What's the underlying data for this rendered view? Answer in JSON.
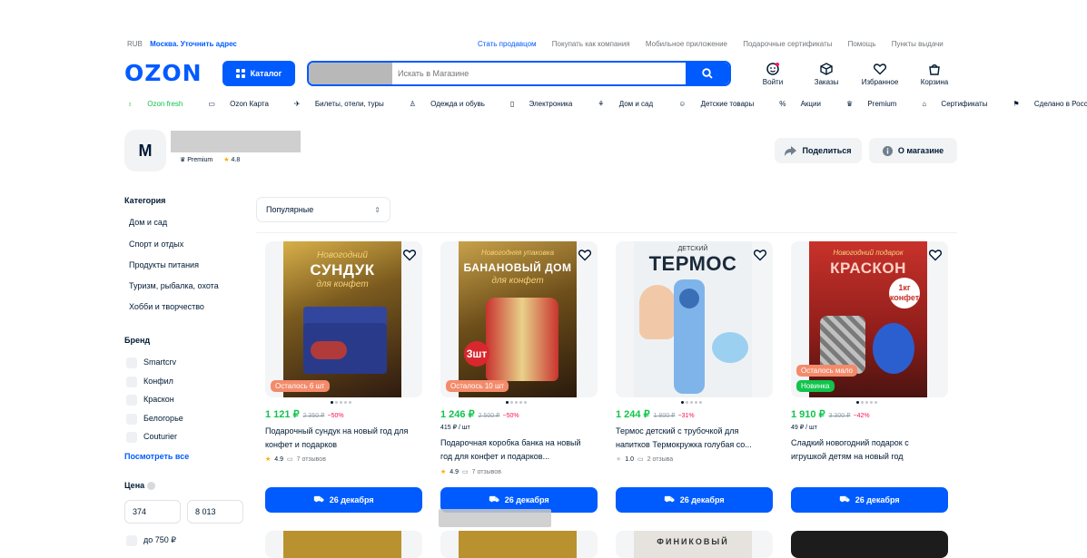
{
  "topbar": {
    "currency": "RUB",
    "location": "Москва. Уточнить адрес",
    "links": [
      "Стать продавцом",
      "Покупать как компания",
      "Мобильное приложение",
      "Подарочные сертификаты",
      "Помощь",
      "Пункты выдачи"
    ]
  },
  "header": {
    "logo": "OZON",
    "catalog_label": "Каталог",
    "search_placeholder": "Искать в Магазине",
    "icons": [
      {
        "label": "Войти",
        "icon": "user-face-icon"
      },
      {
        "label": "Заказы",
        "icon": "box-icon"
      },
      {
        "label": "Избранное",
        "icon": "heart-icon"
      },
      {
        "label": "Корзина",
        "icon": "bag-icon"
      }
    ]
  },
  "nav": [
    "Ozon fresh",
    "Ozon Карта",
    "Билеты, отели, туры",
    "Одежда и обувь",
    "Электроника",
    "Дом и сад",
    "Детские товары",
    "Акции",
    "Premium",
    "Сертификаты",
    "Сделано в России"
  ],
  "shop": {
    "avatar_letter": "M",
    "premium_label": "Premium",
    "rating": "4.8",
    "share_label": "Поделиться",
    "about_label": "О магазине"
  },
  "sidebar": {
    "category_title": "Категория",
    "categories": [
      "Дом и сад",
      "Спорт и отдых",
      "Продукты питания",
      "Туризм, рыбалка, охота",
      "Хобби и творчество"
    ],
    "brand_title": "Бренд",
    "brands": [
      "Smartcrv",
      "Конфил",
      "Краскон",
      "Белогорье",
      "Couturier"
    ],
    "see_all": "Посмотреть все",
    "price_title": "Цена",
    "price_from": "374",
    "price_to": "8 013",
    "price_option": "до 750 ₽"
  },
  "sort": {
    "selected": "Популярные"
  },
  "products": [
    {
      "img_script": "Новогодний",
      "img_title": "СУНДУК",
      "img_sub": "для конфет",
      "tag": "Осталось 6 шт",
      "price": "1 121 ₽",
      "old_price": "2 350 ₽",
      "discount": "−50%",
      "unit": "",
      "title": "Подарочный сундук на новый год для конфет и подарков",
      "rating": "4.9",
      "reviews": "7 отзывов",
      "delivery": "26 декабря"
    },
    {
      "img_script": "Новогодняя упаковка",
      "img_title": "БАНАНОВЫЙ ДОМ",
      "img_sub": "для конфет",
      "tag": "Осталось 10 шт",
      "price": "1 246 ₽",
      "old_price": "2 500 ₽",
      "discount": "−50%",
      "unit": "415 ₽ / шт",
      "title": "Подарочная коробка банка на новый год для конфет и подарков...",
      "rating": "4.9",
      "reviews": "7 отзывов",
      "delivery": "26 декабря"
    },
    {
      "img_script": "ДЕТСКИЙ",
      "img_title": "ТЕРМОС",
      "img_sub": "",
      "tag": "",
      "price": "1 244 ₽",
      "old_price": "1 800 ₽",
      "discount": "−31%",
      "unit": "",
      "title": "Термос детский с трубочкой для напитков Термокружка голубая со...",
      "rating": "1.0",
      "reviews": "2 отзыва",
      "delivery": "26 декабря"
    },
    {
      "img_script": "Новогодний подарок",
      "img_title": "КРАСКОН",
      "img_sub": "1кг конфет",
      "tag": "Осталось мало",
      "tag2": "Новинка",
      "price": "1 910 ₽",
      "old_price": "3 300 ₽",
      "discount": "−42%",
      "unit": "49 ₽ / шт",
      "title": "Сладкий новогодний подарок с игрушкой детям на новый год",
      "rating": "",
      "reviews": "",
      "delivery": "26 декабря"
    }
  ],
  "row2": {
    "third_label": "ФИНИКОВЫЙ"
  },
  "colors": {
    "brand": "#005bff",
    "price": "#10c44c",
    "discount": "#f91155"
  }
}
